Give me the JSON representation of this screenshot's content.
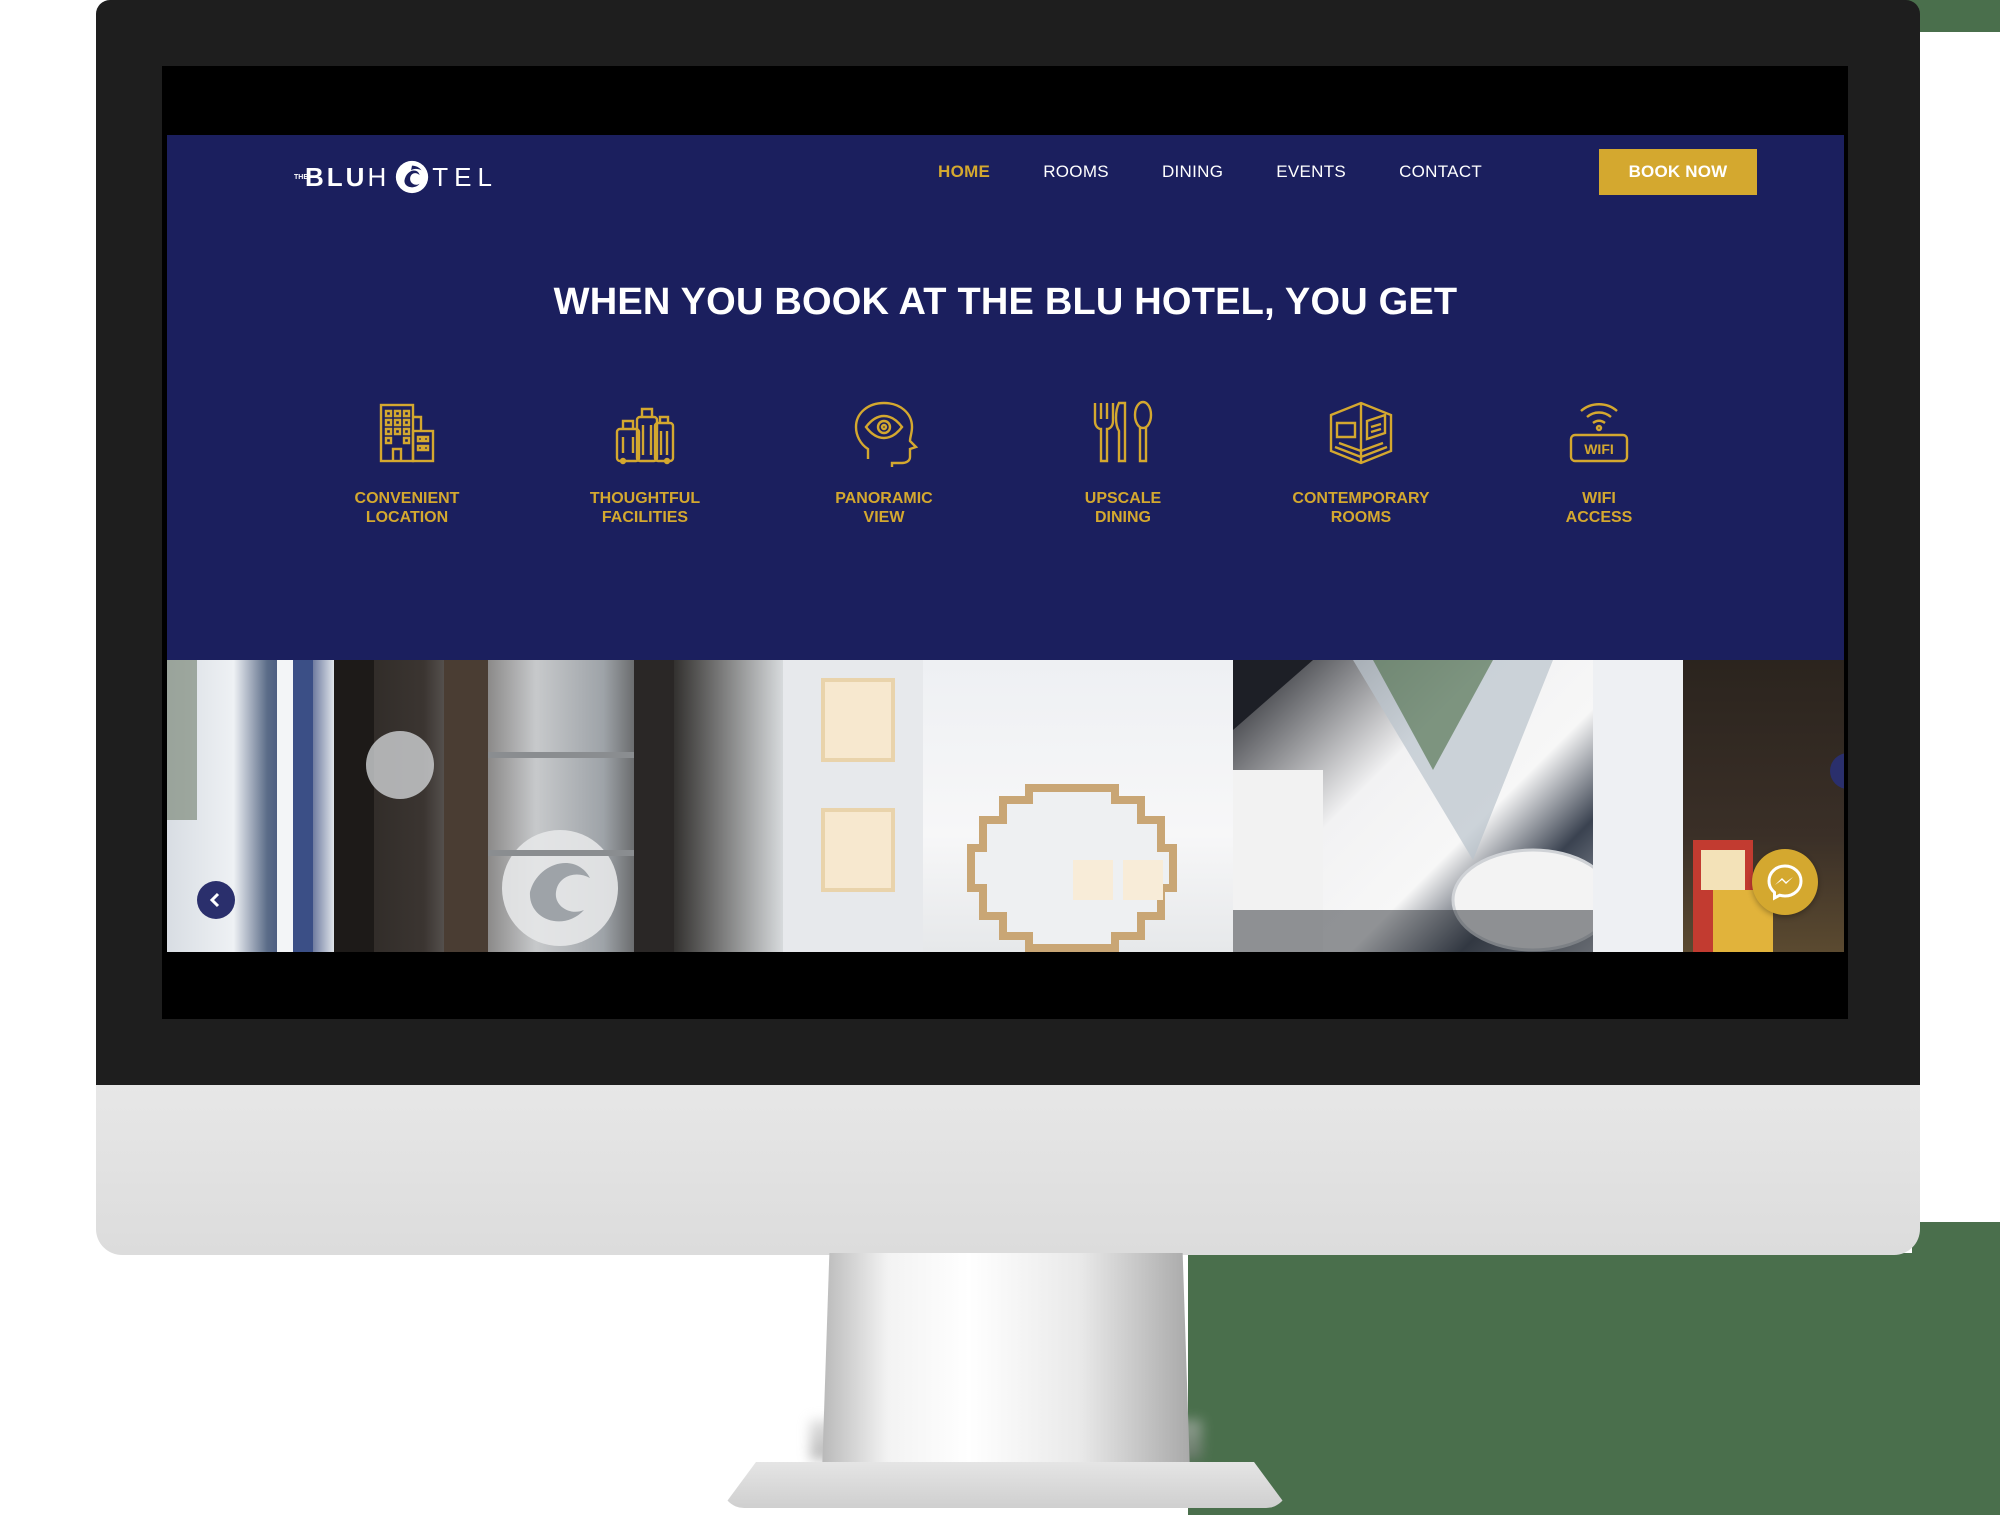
{
  "brand": {
    "logo_small": "THE",
    "logo_bold": "BLU",
    "logo_h": "H",
    "logo_rest": "TEL"
  },
  "nav": {
    "items": [
      {
        "label": "HOME",
        "active": true
      },
      {
        "label": "ROOMS",
        "active": false
      },
      {
        "label": "DINING",
        "active": false
      },
      {
        "label": "EVENTS",
        "active": false
      },
      {
        "label": "CONTACT",
        "active": false
      }
    ],
    "cta": "BOOK NOW"
  },
  "hero": {
    "headline": "WHEN YOU BOOK AT THE BLU HOTEL, YOU GET"
  },
  "features": [
    {
      "label": "CONVENIENT\nLOCATION",
      "icon": "building-icon"
    },
    {
      "label": "THOUGHTFUL\nFACILITIES",
      "icon": "luggage-icon"
    },
    {
      "label": "PANORAMIC\nVIEW",
      "icon": "eye-head-icon"
    },
    {
      "label": "UPSCALE\nDINING",
      "icon": "cutlery-icon"
    },
    {
      "label": "CONTEMPORARY\nROOMS",
      "icon": "room-icon"
    },
    {
      "label": "WIFI\nACCESS",
      "icon": "wifi-icon"
    }
  ],
  "wifi_icon_text": "WIFI",
  "colors": {
    "page_bg": "#1b1f5e",
    "accent_gold": "#d4a82f",
    "text_white": "#ffffff",
    "bezel": "#1e1e1e"
  }
}
